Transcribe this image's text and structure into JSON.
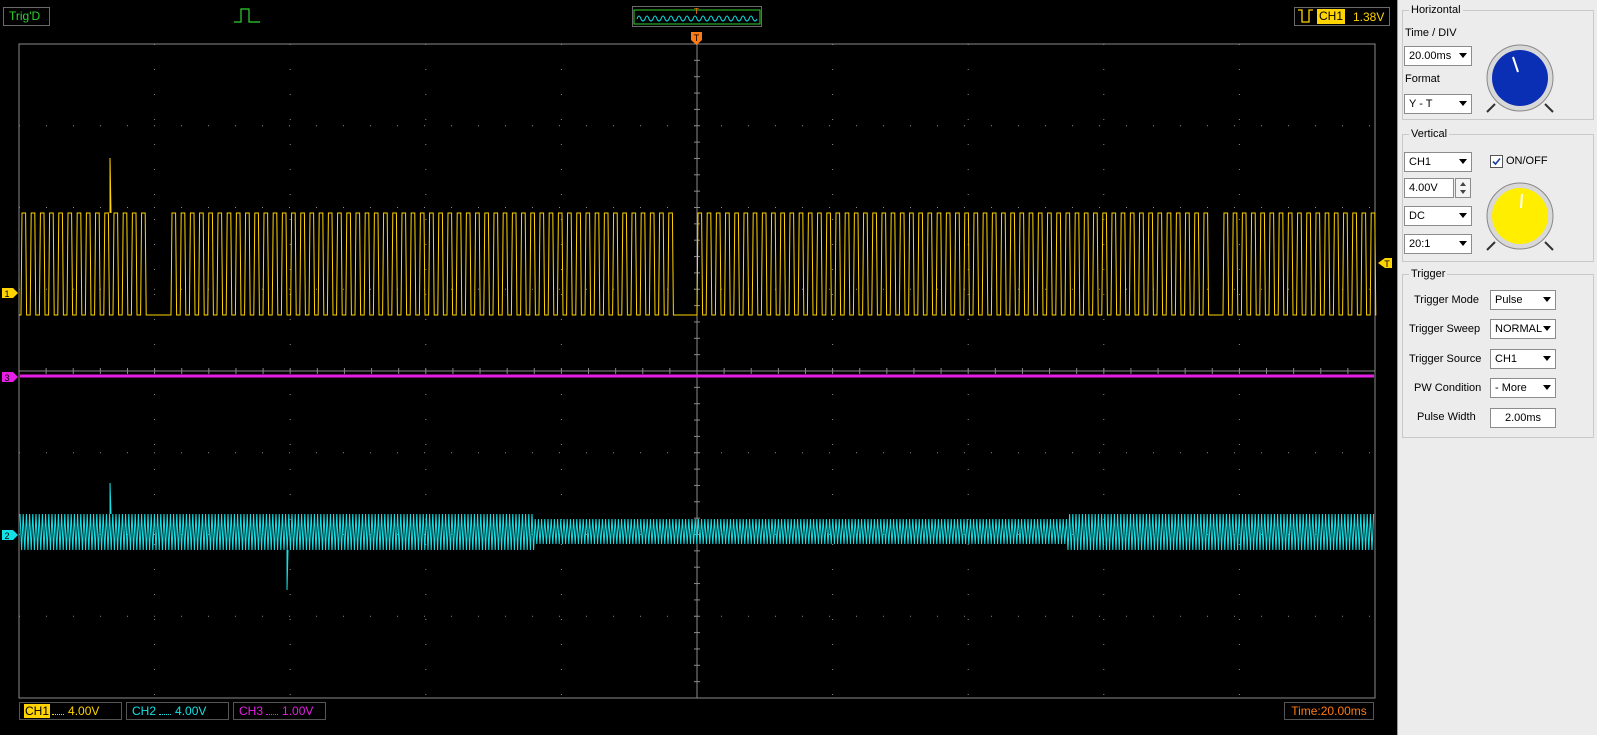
{
  "top_bar": {
    "trigger_status": "Trig'D",
    "trigger_overview_marker": "T",
    "trigger_channel": "CH1",
    "trigger_level": "1.38V"
  },
  "screen": {
    "trigger_position_marker": "T",
    "trigger_level_marker": "T",
    "channel_markers": [
      "1",
      "3",
      "2"
    ],
    "colors": {
      "ch1": "#ffd400",
      "ch2": "#14e1e6",
      "ch3": "#e61ee6",
      "grid": "#8a8a8a",
      "trigger": "#ff7a10"
    }
  },
  "bottom_bar": {
    "ch1": {
      "name": "CH1",
      "scale": "4.00V"
    },
    "ch2": {
      "name": "CH2",
      "scale": "4.00V"
    },
    "ch3": {
      "name": "CH3",
      "scale": "1.00V"
    },
    "time": "Time:20.00ms"
  },
  "panel": {
    "horizontal": {
      "title": "Horizontal",
      "time_div_label": "Time / DIV",
      "time_div_value": "20.00ms",
      "format_label": "Format",
      "format_value": "Y - T",
      "knob_color": "#0a2fb4"
    },
    "vertical": {
      "title": "Vertical",
      "channel_value": "CH1",
      "on_off_label": "ON/OFF",
      "on_off_checked": true,
      "volts_value": "4.00V",
      "coupling_value": "DC",
      "probe_value": "20:1",
      "knob_color": "#ffee00"
    },
    "trigger": {
      "title": "Trigger",
      "mode_label": "Trigger Mode",
      "mode_value": "Pulse",
      "sweep_label": "Trigger Sweep",
      "sweep_value": "NORMAL",
      "source_label": "Trigger Source",
      "source_value": "CH1",
      "pw_condition_label": "PW Condition",
      "pw_condition_value": "- More",
      "pulse_width_label": "Pulse Width",
      "pulse_width_value": "2.00ms"
    }
  }
}
